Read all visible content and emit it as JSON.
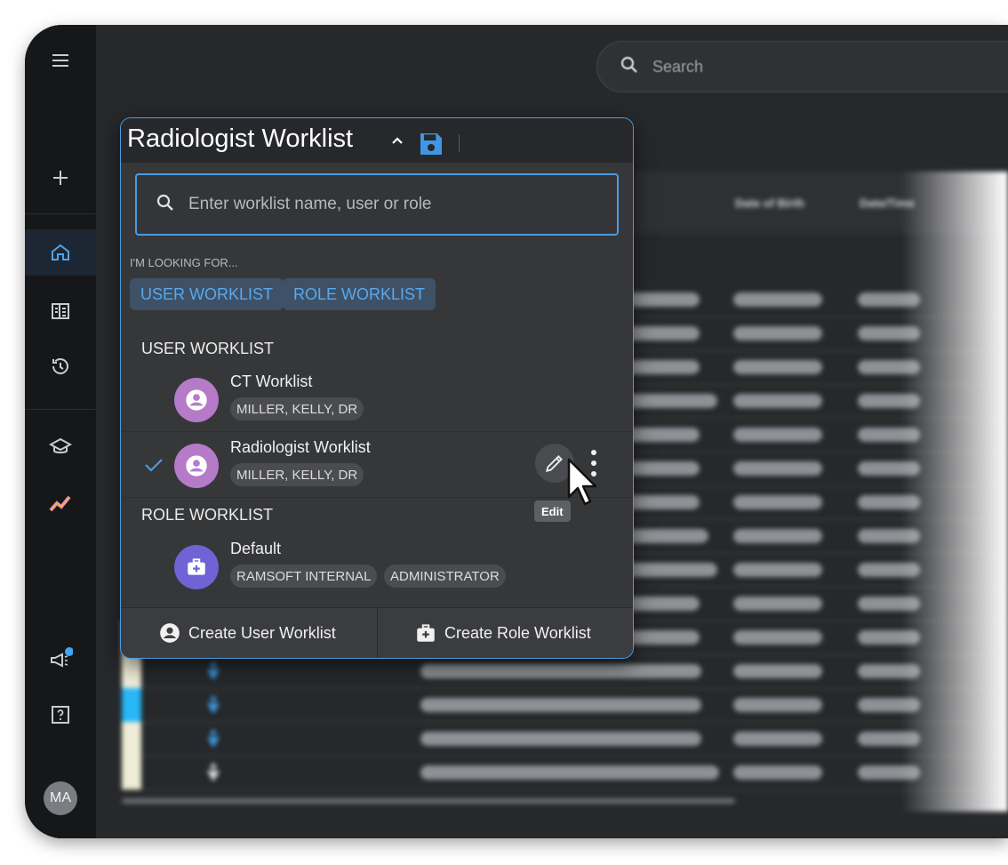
{
  "search": {
    "placeholder": "Search"
  },
  "table_header": {
    "col_dob": "Date of Birth",
    "col_other": "Date/Time"
  },
  "sidebar": {
    "user_initials": "MA",
    "items": [
      "menu-icon",
      "add-icon",
      "home-icon",
      "worklist-icon",
      "history-icon",
      "teaching-icon",
      "analytics-icon",
      "announcements-icon",
      "help-icon"
    ],
    "notification_color": "#42a5f5"
  },
  "worklist_panel": {
    "title": "Radiologist Worklist",
    "search_placeholder": "Enter worklist name, user or role",
    "looking_for_label": "I'M LOOKING FOR...",
    "filter_chips": [
      "USER WORKLIST",
      "ROLE WORKLIST"
    ],
    "user_section_label": "USER WORKLIST",
    "user_worklists": [
      {
        "name": "CT Worklist",
        "tags": [
          "MILLER, KELLY, DR"
        ],
        "selected": false
      },
      {
        "name": "Radiologist Worklist",
        "tags": [
          "MILLER, KELLY, DR"
        ],
        "selected": true
      }
    ],
    "role_section_label": "ROLE WORKLIST",
    "role_worklists": [
      {
        "name": "Default",
        "tags": [
          "RAMSOFT INTERNAL",
          "ADMINISTRATOR"
        ]
      }
    ],
    "edit_tooltip": "Edit",
    "create_user_label": "Create User Worklist",
    "create_role_label": "Create Role Worklist"
  },
  "colors": {
    "accent": "#4d9be0",
    "chip_text": "#58a9ef",
    "user_avatar": "#b57bc9",
    "role_avatar": "#6f63d6",
    "save_icon": "#3f96e6"
  }
}
